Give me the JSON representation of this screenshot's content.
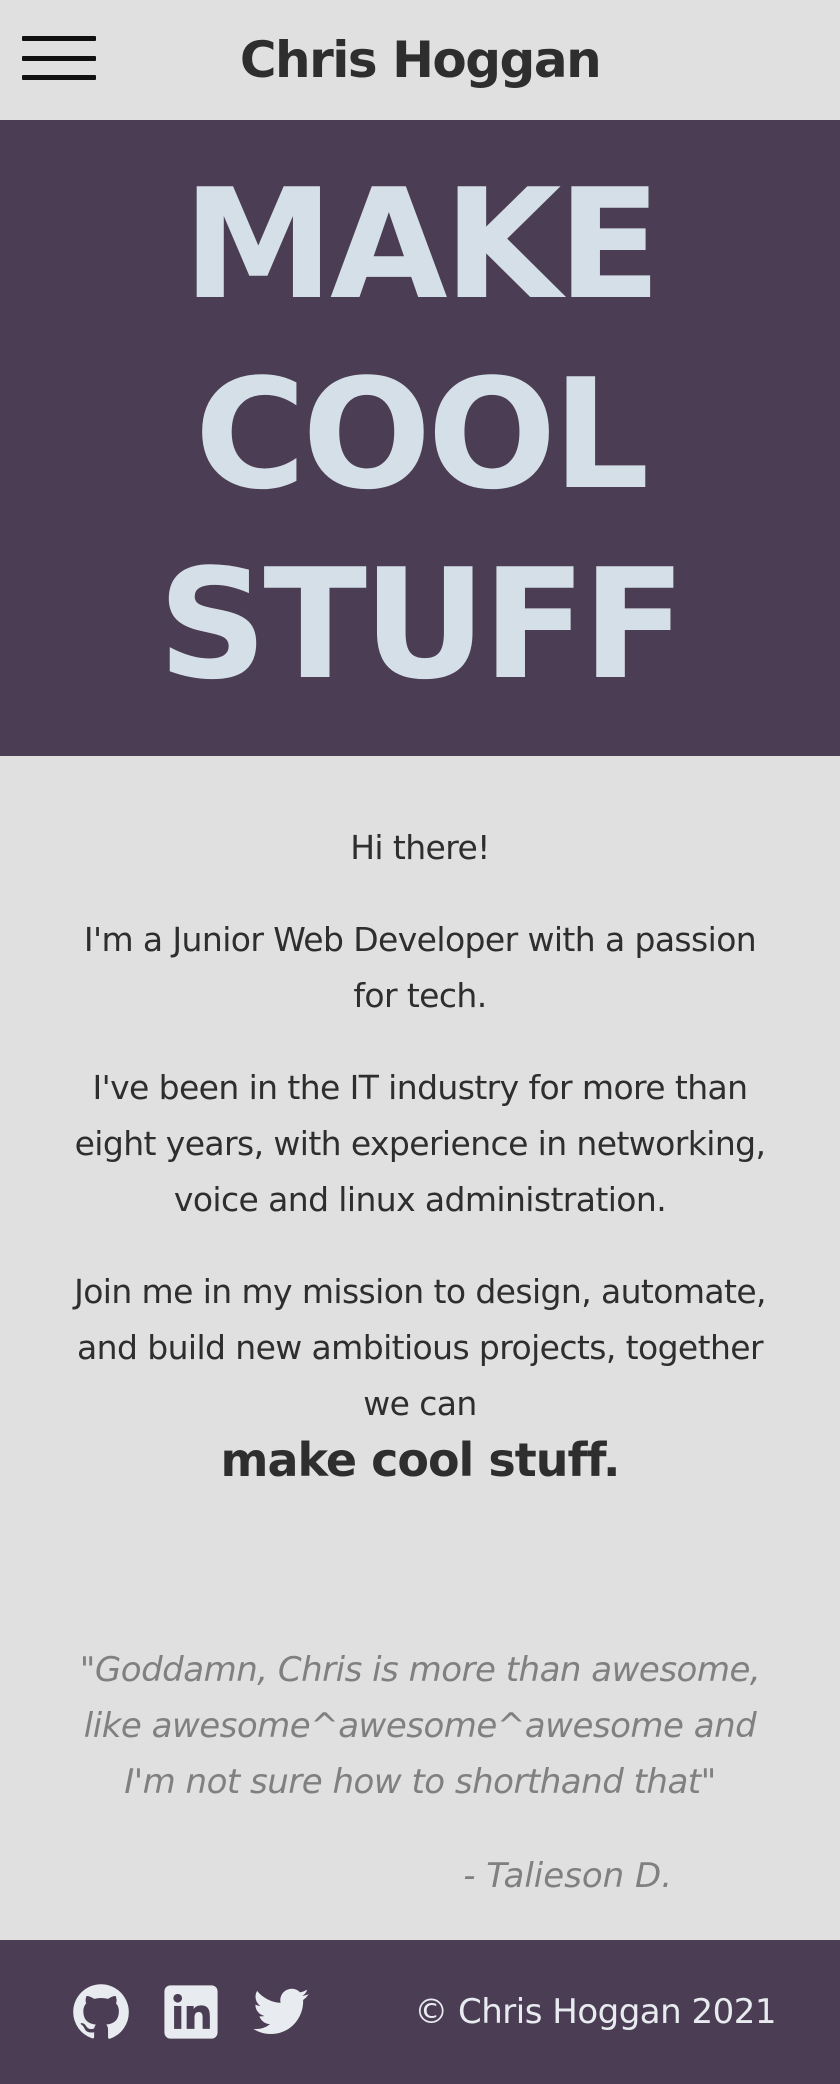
{
  "header": {
    "title": "Chris Hoggan",
    "menu_icon": "hamburger-menu-icon"
  },
  "hero": {
    "lines": [
      "MAKE",
      "COOL",
      "STUFF"
    ]
  },
  "about": {
    "greeting": "Hi there!",
    "intro": "I'm a Junior Web Developer with a passion for tech.",
    "experience": "I've been in the IT industry for more than eight years, with experience in networking, voice and linux administration.",
    "mission": "Join me in my mission to design, automate, and build new ambitious projects, together we can",
    "tagline": "make cool stuff."
  },
  "testimonial": {
    "quote": "\"Goddamn, Chris is more than awesome, like awesome^awesome^awesome and I'm not sure how to shorthand that\"",
    "author": "- Talieson D."
  },
  "footer": {
    "social": [
      {
        "name": "github",
        "icon": "github-icon"
      },
      {
        "name": "linkedin",
        "icon": "linkedin-icon"
      },
      {
        "name": "twitter",
        "icon": "twitter-icon"
      }
    ],
    "copyright": "© Chris Hoggan 2021"
  },
  "colors": {
    "background": "#e0e0e0",
    "accent": "#4b3e54",
    "hero_text": "#d5dfe8",
    "body_text": "#2e2e2e",
    "quote_text": "#808080"
  }
}
